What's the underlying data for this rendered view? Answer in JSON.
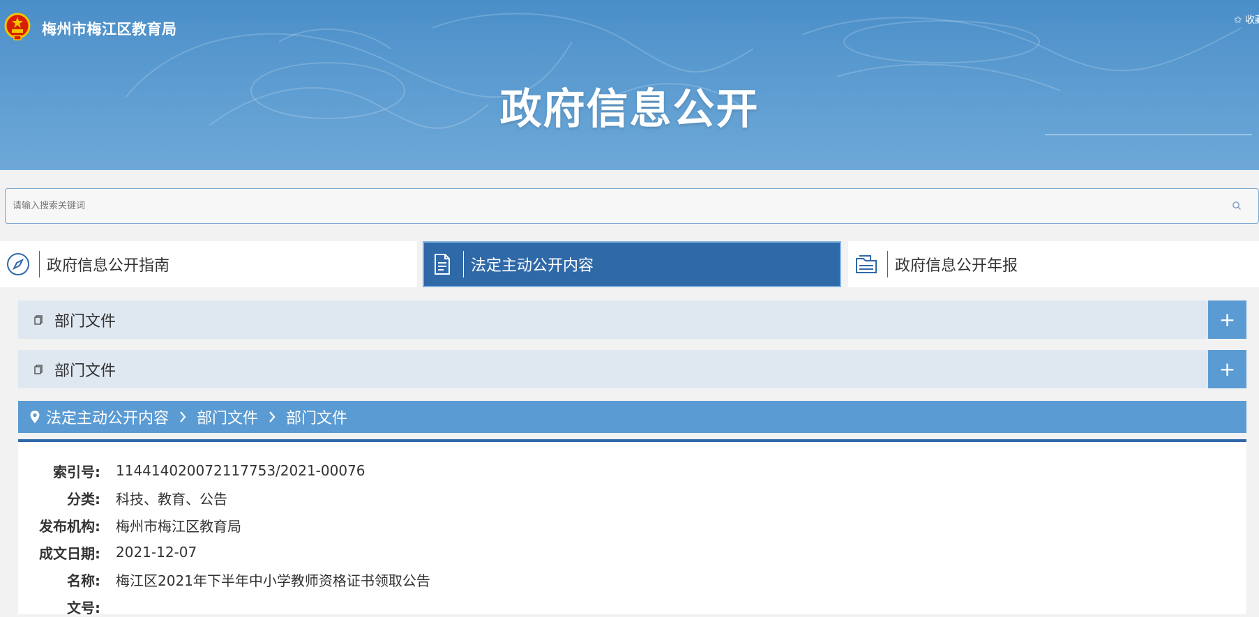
{
  "header": {
    "org_name": "梅州市梅江区教育局",
    "favorite_label": "✩ 收藏",
    "title": "政府信息公开"
  },
  "search": {
    "placeholder": "请输入搜索关键词",
    "value": ""
  },
  "tabs": [
    {
      "label": "政府信息公开指南",
      "icon": "compass-icon",
      "active": false
    },
    {
      "label": "法定主动公开内容",
      "icon": "document-icon",
      "active": true
    },
    {
      "label": "政府信息公开年报",
      "icon": "folder-icon",
      "active": false
    }
  ],
  "sections": [
    {
      "label": "部门文件",
      "toggle": "+",
      "icon": "copy-icon"
    },
    {
      "label": "部门文件",
      "toggle": "+",
      "icon": "copy-icon"
    }
  ],
  "breadcrumb": [
    "法定主动公开内容",
    "部门文件",
    "部门文件"
  ],
  "details": [
    {
      "key": "索引号:",
      "value": "114414020072117753/2021-00076"
    },
    {
      "key": "分类:",
      "value": "科技、教育、公告"
    },
    {
      "key": "发布机构:",
      "value": "梅州市梅江区教育局"
    },
    {
      "key": "成文日期:",
      "value": "2021-12-07"
    },
    {
      "key": "名称:",
      "value": "梅江区2021年下半年中小学教师资格证书领取公告"
    },
    {
      "key": "文号:",
      "value": ""
    }
  ],
  "colors": {
    "banner": "#5b9bd0",
    "tab_active": "#2f69a8",
    "accordion_bg": "#dfe8f1",
    "toggle_bg": "#5b9bd3",
    "breadcrumb_bg": "#5b9bd3",
    "emblem_red": "#d81e06",
    "emblem_gold": "#f5c400"
  }
}
